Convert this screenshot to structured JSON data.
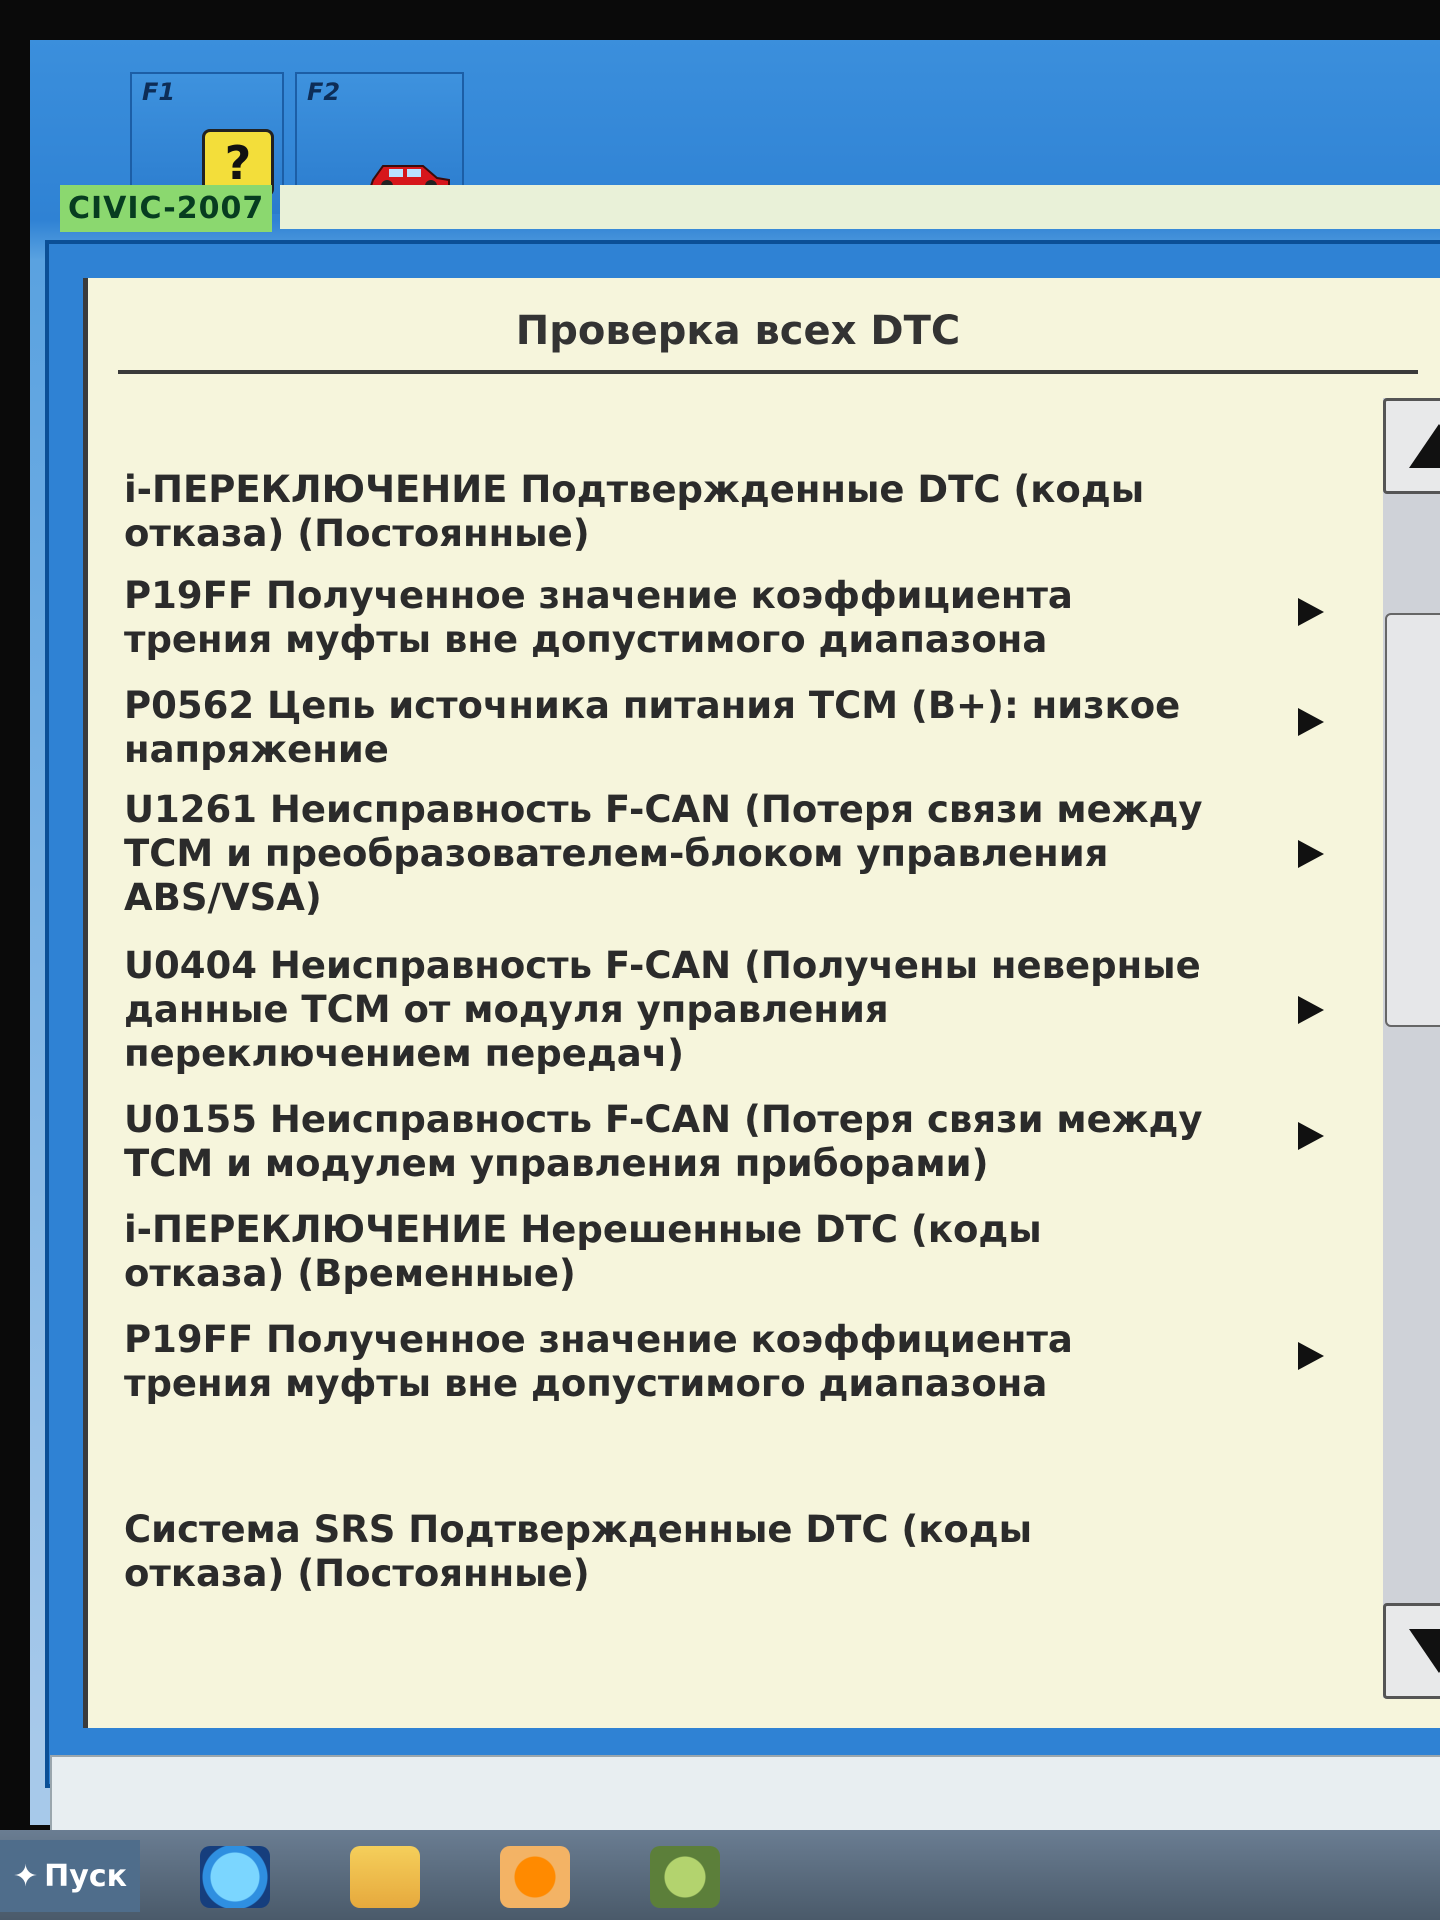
{
  "tabs": [
    {
      "key": "F1",
      "icon": "help-icon",
      "help_symbol": "?"
    },
    {
      "key": "F2",
      "icon": "car-icon"
    }
  ],
  "vehicle": {
    "model": "CIVIC-2007"
  },
  "panel": {
    "title": "Проверка всех DTC",
    "items": [
      {
        "text": "i-ПЕРЕКЛЮЧЕНИЕ Подтвержденные DTC (коды отказа) (Постоянные)",
        "arrow": false
      },
      {
        "text": "P19FF Полученное значение коэффициента трения муфты вне допустимого диапазона",
        "arrow": true
      },
      {
        "text": "P0562 Цепь источника питания TCM (B+): низкое напряжение",
        "arrow": true
      },
      {
        "text": "U1261 Неисправность F-CAN (Потеря связи между TCM и преобразователем-блоком управления ABS/VSA)",
        "arrow": true
      },
      {
        "text": "U0404 Неисправность F-CAN (Получены неверные данные TCM от модуля управления переключением передач)",
        "arrow": true
      },
      {
        "text": "U0155 Неисправность F-CAN (Потеря связи между TCM и модулем управления приборами)",
        "arrow": true
      },
      {
        "text": "i-ПЕРЕКЛЮЧЕНИЕ Нерешенные DTC (коды отказа) (Временные)",
        "arrow": false
      },
      {
        "text": "P19FF Полученное значение коэффициента трения муфты вне допустимого диапазона",
        "arrow": true
      },
      {
        "text": "Система SRS Подтвержденные DTC (коды отказа) (Постоянные)",
        "arrow": false
      }
    ]
  },
  "taskbar": {
    "start_label": "Пуск"
  },
  "colors": {
    "panel_bg": "#f6f5dc",
    "frame_blue": "#2f82d4",
    "model_badge": "#8bd86f"
  }
}
